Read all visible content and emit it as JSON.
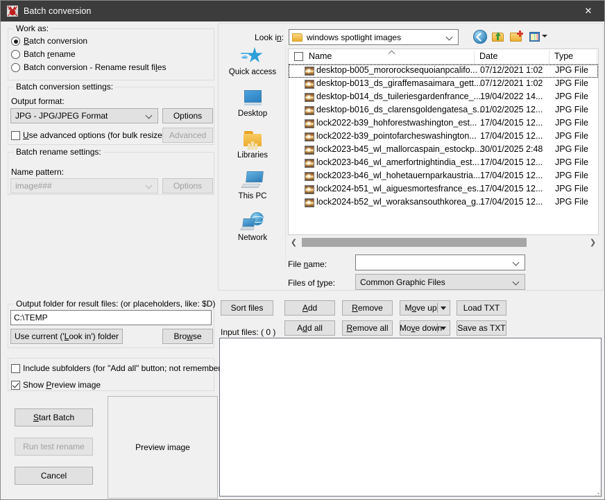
{
  "window": {
    "title": "Batch conversion",
    "icon": "irfanview-cat-icon",
    "close_label": "✕"
  },
  "work_as": {
    "group_label": "Work as:",
    "options": [
      {
        "label": "Batch conversion",
        "accel": "B",
        "selected": true
      },
      {
        "label": "Batch rename",
        "accel": "r",
        "selected": false
      },
      {
        "label": "Batch conversion - Rename result files",
        "accel": "l",
        "selected": false
      }
    ]
  },
  "conversion_settings": {
    "group_label": "Batch conversion settings:",
    "output_format_label": "Output format:",
    "output_format_value": "JPG - JPG/JPEG Format",
    "options_button": "Options",
    "advanced_checkbox": "Use advanced options (for bulk resize...)",
    "advanced_checkbox_checked": false,
    "advanced_button": "Advanced",
    "advanced_button_enabled": false
  },
  "rename_settings": {
    "group_label": "Batch rename settings:",
    "name_pattern_label": "Name pattern:",
    "name_pattern_value": "image###",
    "name_pattern_enabled": false,
    "options_button": "Options",
    "options_button_enabled": false
  },
  "output_folder": {
    "group_label": "Output folder for result files: (or placeholders, like: $D)",
    "path_value": "C:\\TEMP",
    "use_current_button": "Use current ('Look in') folder",
    "browse_button": "Browse"
  },
  "misc_options": {
    "include_subfolders": "Include subfolders (for \"Add all\" button; not remembered)",
    "include_subfolders_checked": false,
    "show_preview": "Show Preview image",
    "show_preview_checked": true
  },
  "action_buttons": {
    "start_batch": "Start Batch",
    "run_test_rename": "Run test rename",
    "run_test_rename_enabled": false,
    "cancel": "Cancel"
  },
  "preview": {
    "placeholder": "Preview image"
  },
  "browser": {
    "look_in_label": "Look in:",
    "look_in_value": "windows spotlight images",
    "toolbar": [
      {
        "name": "back-icon"
      },
      {
        "name": "up-folder-icon"
      },
      {
        "name": "new-folder-icon"
      },
      {
        "name": "views-icon"
      }
    ],
    "columns": [
      "Name",
      "Date",
      "Type"
    ],
    "header_checkbox_checked": false,
    "sort_column": "Name",
    "sort_direction": "asc",
    "files": [
      {
        "name": "desktop-b005_mororocksequoianpcalifo...",
        "date": "07/12/2021 1:02",
        "type": "JPG File",
        "focused": true
      },
      {
        "name": "desktop-b013_ds_giraffemasaimara_gett...",
        "date": "07/12/2021 1:02",
        "type": "JPG File",
        "focused": false
      },
      {
        "name": "desktop-b014_ds_tuileriesgardenfrance_...",
        "date": "19/04/2022 14...",
        "type": "JPG File",
        "focused": false
      },
      {
        "name": "desktop-b016_ds_clarensgoldengatesa_s...",
        "date": "01/02/2025 12...",
        "type": "JPG File",
        "focused": false
      },
      {
        "name": "lock2022-b39_hohforestwashington_est...",
        "date": "17/04/2015 12...",
        "type": "JPG File",
        "focused": false
      },
      {
        "name": "lock2022-b39_pointofarcheswashington...",
        "date": "17/04/2015 12...",
        "type": "JPG File",
        "focused": false
      },
      {
        "name": "lock2023-b45_wl_mallorcaspain_estockp...",
        "date": "30/01/2025 2:48",
        "type": "JPG File",
        "focused": false
      },
      {
        "name": "lock2023-b46_wl_amerfortnightindia_est...",
        "date": "17/04/2015 12...",
        "type": "JPG File",
        "focused": false
      },
      {
        "name": "lock2023-b46_wl_hohetauernparkaustria...",
        "date": "17/04/2015 12...",
        "type": "JPG File",
        "focused": false
      },
      {
        "name": "lock2024-b51_wl_aiguesmortesfrance_es...",
        "date": "17/04/2015 12...",
        "type": "JPG File",
        "focused": false
      },
      {
        "name": "lock2024-b52_wl_woraksansouthkorea_g...",
        "date": "17/04/2015 12...",
        "type": "JPG File",
        "focused": false
      }
    ],
    "places": [
      {
        "label": "Quick access",
        "icon": "quick-access-star-icon"
      },
      {
        "label": "Desktop",
        "icon": "desktop-monitor-icon"
      },
      {
        "label": "Libraries",
        "icon": "libraries-folder-icon"
      },
      {
        "label": "This PC",
        "icon": "this-pc-icon"
      },
      {
        "label": "Network",
        "icon": "network-globe-icon"
      }
    ],
    "file_name_label": "File name:",
    "file_name_value": "",
    "files_of_type_label": "Files of type:",
    "files_of_type_value": "Common Graphic Files"
  },
  "file_actions": {
    "sort_files": "Sort files",
    "add": "Add",
    "remove": "Remove",
    "move_up": "Move up",
    "load_txt": "Load TXT",
    "input_files_label": "Input files: ( 0 )",
    "add_all": "Add all",
    "remove_all": "Remove all",
    "move_down": "Move down",
    "save_as_txt": "Save as TXT"
  },
  "colors": {
    "titlebar": "#3c3c3c",
    "dialog_bg": "#f0f0f0",
    "button_bg": "#e1e1e1",
    "accent_blue": "#2e82bb",
    "folder_yellow": "#eeae30"
  }
}
